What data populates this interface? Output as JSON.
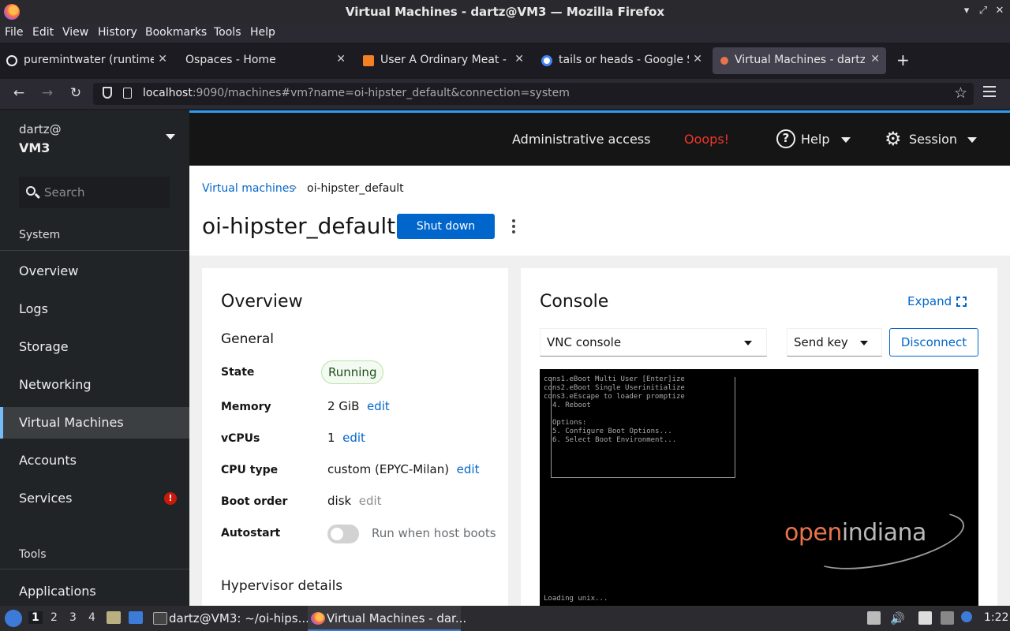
{
  "window": {
    "title": "Virtual Machines - dartz@VM3 — Mozilla Firefox",
    "controls": [
      "▾",
      "⤢",
      "✕"
    ]
  },
  "menu": [
    "File",
    "Edit",
    "View",
    "History",
    "Bookmarks",
    "Tools",
    "Help"
  ],
  "tabs": [
    {
      "label": "puremintwater (runtime)",
      "icon_color": "#eee"
    },
    {
      "label": "Ospaces - Home",
      "icon_color": ""
    },
    {
      "label": "User A Ordinary Meat - S",
      "icon_color": "#f48024"
    },
    {
      "label": "tails or heads - Google Se",
      "icon_color": "#4285f4"
    },
    {
      "label": "Virtual Machines - dartz@",
      "icon_color": "#e8744c"
    }
  ],
  "tab_close": "✕",
  "new_tab": "+",
  "nav": {
    "back": "←",
    "forward": "→",
    "reload": "↻",
    "star": "☆",
    "url_host": "localhost",
    "url_rest": ":9090/machines#vm?name=oi-hipster_default&connection=system"
  },
  "sidebar": {
    "user": "dartz@",
    "host": "VM3",
    "search_placeholder": "Search",
    "section_system": "System",
    "items": [
      "Overview",
      "Logs",
      "Storage",
      "Networking",
      "Virtual Machines",
      "Accounts",
      "Services"
    ],
    "active": "Virtual Machines",
    "services_alert": "!",
    "section_tools": "Tools",
    "tools_items": [
      "Applications"
    ]
  },
  "masthead": {
    "admin": "Administrative access",
    "oops": "Ooops!",
    "help": "Help",
    "help_icon": "?",
    "session": "Session",
    "gear_icon": "⚙"
  },
  "breadcrumb": {
    "parent": "Virtual machines",
    "sep": "›",
    "current": "oi-hipster_default"
  },
  "vm": {
    "name": "oi-hipster_default",
    "shutdown": "Shut down"
  },
  "overview": {
    "title": "Overview",
    "general": "General",
    "state_label": "State",
    "state": "Running",
    "memory_label": "Memory",
    "memory": "2 GiB",
    "vcpus_label": "vCPUs",
    "vcpus": "1",
    "cpu_label": "CPU type",
    "cpu": "custom (EPYC-Milan)",
    "boot_label": "Boot order",
    "boot": "disk",
    "autostart_label": "Autostart",
    "autostart_text": "Run when host boots",
    "autostart_on": false,
    "edit": "edit",
    "hypervisor": "Hypervisor details"
  },
  "console": {
    "title": "Console",
    "expand": "Expand",
    "type": "VNC console",
    "sendkey": "Send key",
    "disconnect": "Disconnect",
    "screen_lines": [
      "cons1.eBoot Multi User [Enter]ize",
      "cons2.eBoot Single Userinitialize",
      "cons3.eEscape to loader promptize",
      "  4. Reboot",
      "",
      "  Options:",
      "  5. Configure Boot Options...",
      "  6. Select Boot Environment..."
    ],
    "loading": "Loading unix...",
    "logo_a": "open",
    "logo_b": "indiana"
  },
  "taskbar": {
    "workspaces": [
      "1",
      "2",
      "3",
      "4"
    ],
    "task1": "dartz@VM3: ~/oi-hips...",
    "task2": "Virtual Machines - dar...",
    "clock": "1:22"
  }
}
